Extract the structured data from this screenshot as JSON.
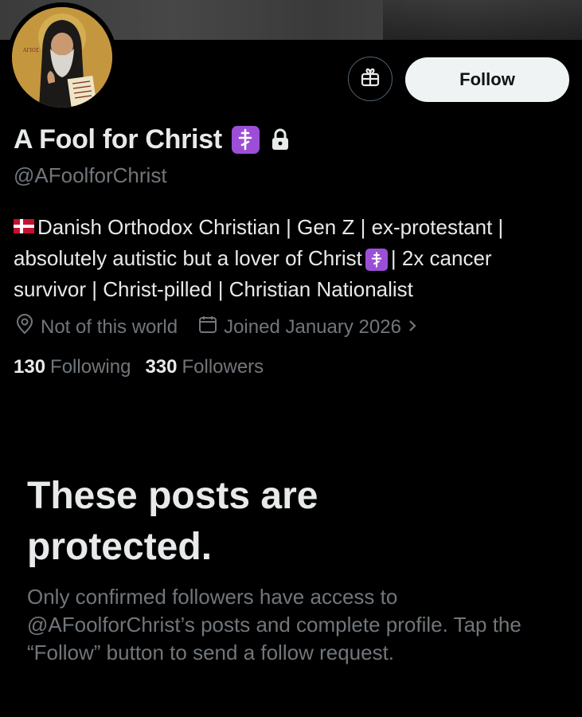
{
  "profile": {
    "display_name": "A Fool for Christ",
    "handle": "@AFoolforChrist",
    "bio_line1": "Danish Orthodox Christian | Gen Z | ex-protestant |",
    "bio_line2a": "absolutely autistic but a lover of Christ",
    "bio_line2b": "| 2x cancer",
    "bio_line3": "survivor | Christ-pilled | Christian Nationalist",
    "location": "Not of this world",
    "joined": "Joined January 2026",
    "following_count": "130",
    "following_label": "Following",
    "followers_count": "330",
    "followers_label": "Followers"
  },
  "actions": {
    "follow_label": "Follow"
  },
  "protected": {
    "title": "These posts are protected.",
    "text": "Only confirmed followers have access to @AFoolforChrist’s posts and complete profile. Tap the “Follow” button to send a follow request."
  },
  "icons": {
    "gift": "gift-icon",
    "lock": "lock-icon",
    "location": "location-pin-icon",
    "calendar": "calendar-icon",
    "chevron": "chevron-right-icon",
    "orthodox_cross": "orthodox-cross-emoji",
    "flag": "denmark-flag-emoji"
  },
  "colors": {
    "background": "#000000",
    "primary_text": "#e7e9ea",
    "secondary_text": "#71767b",
    "follow_button_bg": "#eff3f4",
    "cross_emoji_bg": "#9c4fd6"
  }
}
